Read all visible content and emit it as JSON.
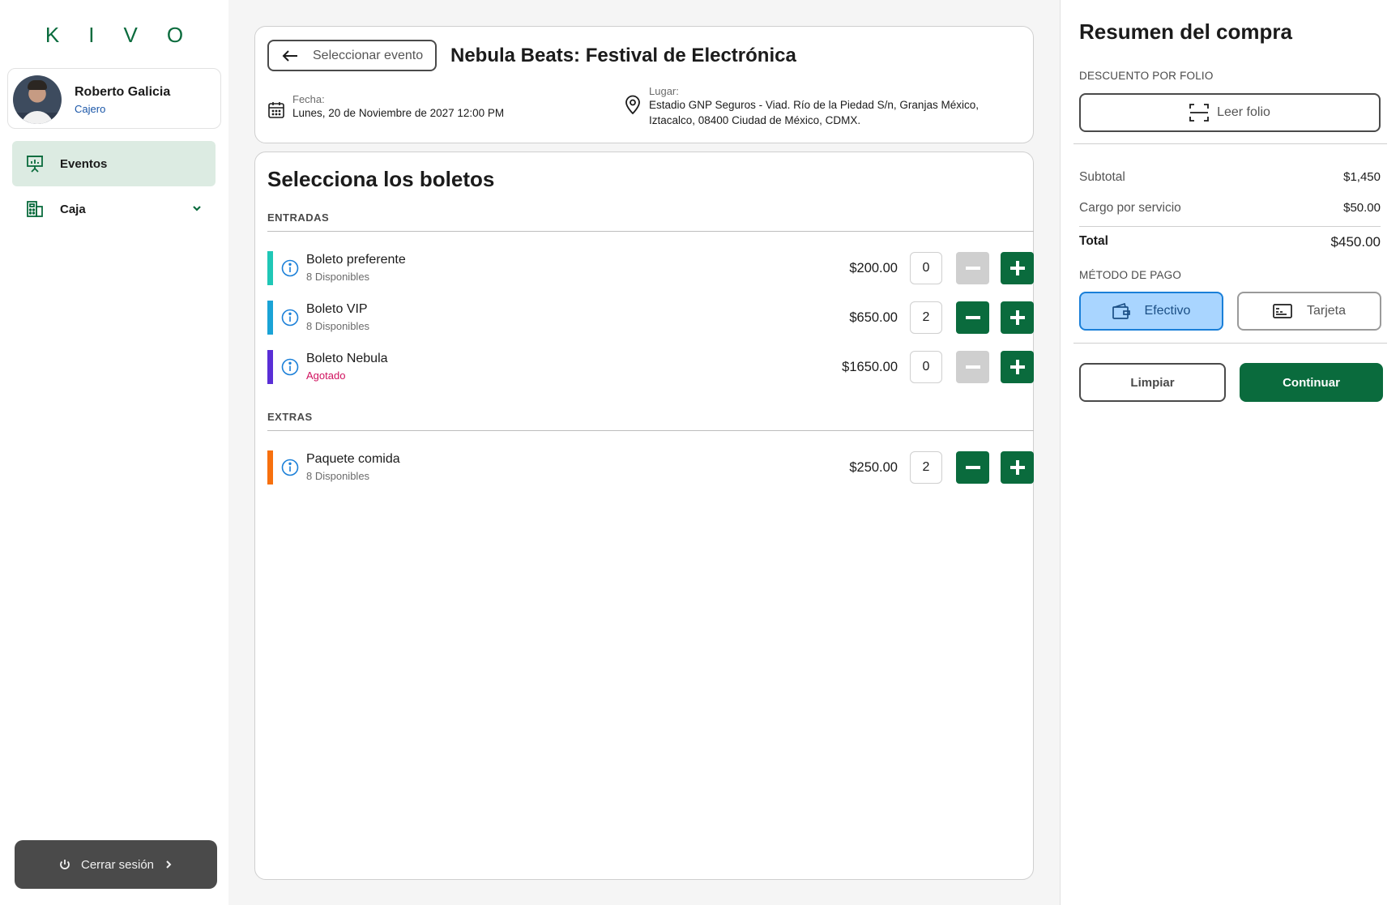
{
  "brand": {
    "logo": "KIVO"
  },
  "user": {
    "name": "Roberto Galicia",
    "role": "Cajero"
  },
  "nav": {
    "items": [
      {
        "label": "Eventos",
        "icon": "presentation-icon",
        "active": true
      },
      {
        "label": "Caja",
        "icon": "cash-register-icon",
        "active": false
      }
    ]
  },
  "logout": {
    "label": "Cerrar sesión"
  },
  "event": {
    "back_label": "Seleccionar evento",
    "title": "Nebula Beats: Festival de Electrónica",
    "date_label": "Fecha:",
    "date_value": "Lunes, 20 de Noviembre de 2027 12:00 PM",
    "place_label": "Lugar:",
    "place_line1": "Estadio GNP Seguros - Viad. Río de la Piedad S/n, Granjas México,",
    "place_line2": "Iztacalco, 08400 Ciudad de México, CDMX."
  },
  "tickets": {
    "title": "Selecciona los boletos",
    "sections": [
      {
        "header": "ENTRADAS",
        "items": [
          {
            "name": "Boleto preferente",
            "availability": "8 Disponibles",
            "price": "$200.00",
            "qty": "0",
            "color": "#1fc7b6",
            "sold_out": false
          },
          {
            "name": "Boleto VIP",
            "availability": "8 Disponibles",
            "price": "$650.00",
            "qty": "2",
            "color": "#1aa3d6",
            "sold_out": false
          },
          {
            "name": "Boleto Nebula",
            "availability": "Agotado",
            "price": "$1650.00",
            "qty": "0",
            "color": "#5a2ed6",
            "sold_out": true
          }
        ]
      },
      {
        "header": "EXTRAS",
        "items": [
          {
            "name": "Paquete comida",
            "availability": "8 Disponibles",
            "price": "$250.00",
            "qty": "2",
            "color": "#f7700e",
            "sold_out": false
          }
        ]
      }
    ]
  },
  "summary": {
    "title": "Resumen del compra",
    "discount_label": "DESCUENTO POR FOLIO",
    "folio_button": "Leer folio",
    "subtotal_label": "Subtotal",
    "subtotal_value": "$1,450",
    "service_label": "Cargo por servicio",
    "service_value": "$50.00",
    "total_label": "Total",
    "total_value": "$450.00",
    "payment_label": "MÉTODO DE PAGO",
    "payment_methods": [
      {
        "label": "Efectivo",
        "icon": "wallet-icon",
        "selected": true
      },
      {
        "label": "Tarjeta",
        "icon": "card-icon",
        "selected": false
      }
    ],
    "clear_button": "Limpiar",
    "continue_button": "Continuar"
  },
  "colors": {
    "accent": "#0a6b3d",
    "selected_blue": "#a9d5ff",
    "sold_out": "#d0115e"
  }
}
